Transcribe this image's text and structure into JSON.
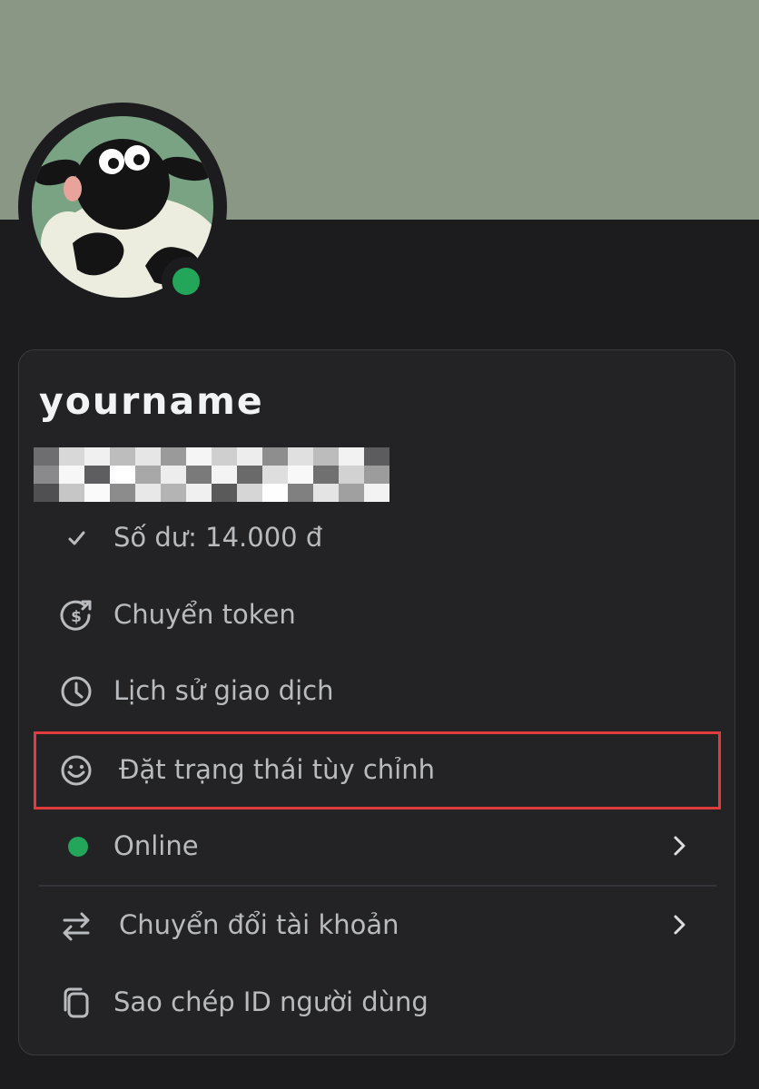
{
  "profile": {
    "username": "yourname",
    "status": "online",
    "status_color": "#23a55a",
    "banner_color": "#8b9785"
  },
  "menu": {
    "balance_label": "Số dư: 14.000 đ",
    "transfer_label": "Chuyển token",
    "history_label": "Lịch sử giao dịch",
    "custom_status_label": "Đặt trạng thái tùy chỉnh",
    "online_label": "Online",
    "switch_account_label": "Chuyển đổi tài khoản",
    "copy_id_label": "Sao chép ID người dùng"
  },
  "colors": {
    "highlight": "#e03c3c",
    "online": "#23a55a"
  }
}
